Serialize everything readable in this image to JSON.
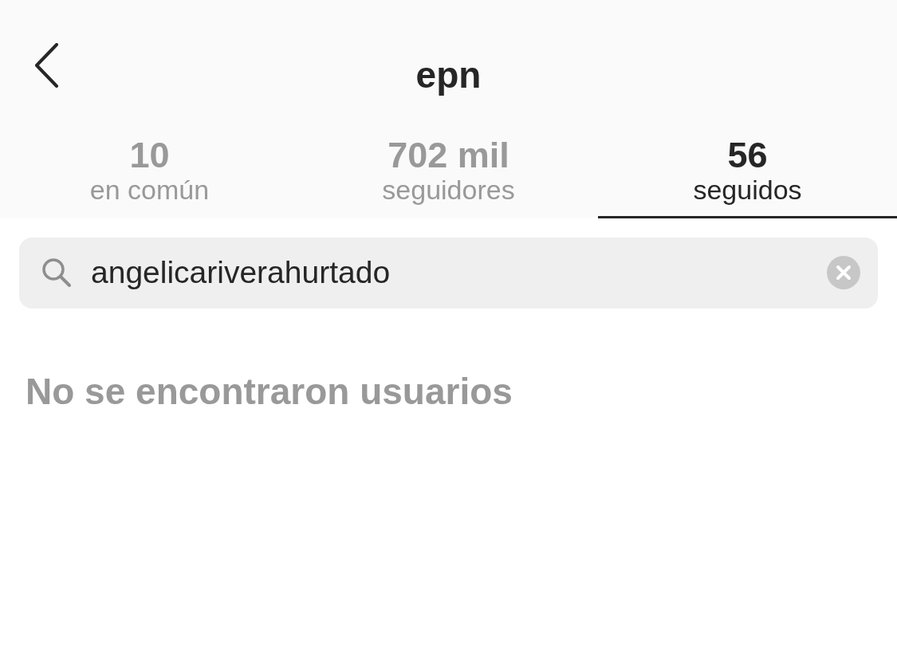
{
  "header": {
    "title": "epn"
  },
  "tabs": [
    {
      "count": "10",
      "label": "en común",
      "selected": false
    },
    {
      "count": "702 mil",
      "label": "seguidores",
      "selected": false
    },
    {
      "count": "56",
      "label": "seguidos",
      "selected": true
    }
  ],
  "search": {
    "value": "angelicariverahurtado"
  },
  "empty_message": "No se encontraron usuarios"
}
